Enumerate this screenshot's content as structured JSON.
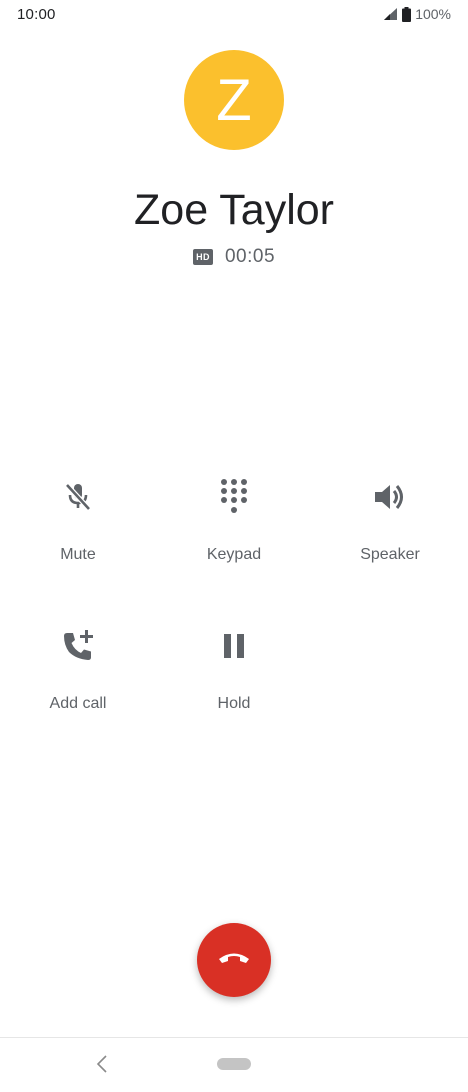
{
  "status_bar": {
    "time": "10:00",
    "battery_percent": "100%",
    "icons": [
      "signal-icon",
      "battery-icon"
    ]
  },
  "contact": {
    "initial": "Z",
    "name": "Zoe Taylor",
    "avatar_color": "#fbc02d"
  },
  "call": {
    "hd_label": "HD",
    "timer": "00:05"
  },
  "controls": [
    {
      "label": "Mute",
      "icon": "mic-off-icon"
    },
    {
      "label": "Keypad",
      "icon": "dialpad-icon"
    },
    {
      "label": "Speaker",
      "icon": "speaker-icon"
    },
    {
      "label": "Add call",
      "icon": "add-call-icon"
    },
    {
      "label": "Hold",
      "icon": "pause-icon"
    }
  ],
  "end_call": {
    "icon": "end-call-icon",
    "color": "#d93025"
  },
  "colors": {
    "icon_gray": "#5f6368",
    "text_dark": "#202124"
  },
  "nav_bar": {
    "back_icon": "back-chevron-icon",
    "home_icon": "home-pill-icon"
  }
}
